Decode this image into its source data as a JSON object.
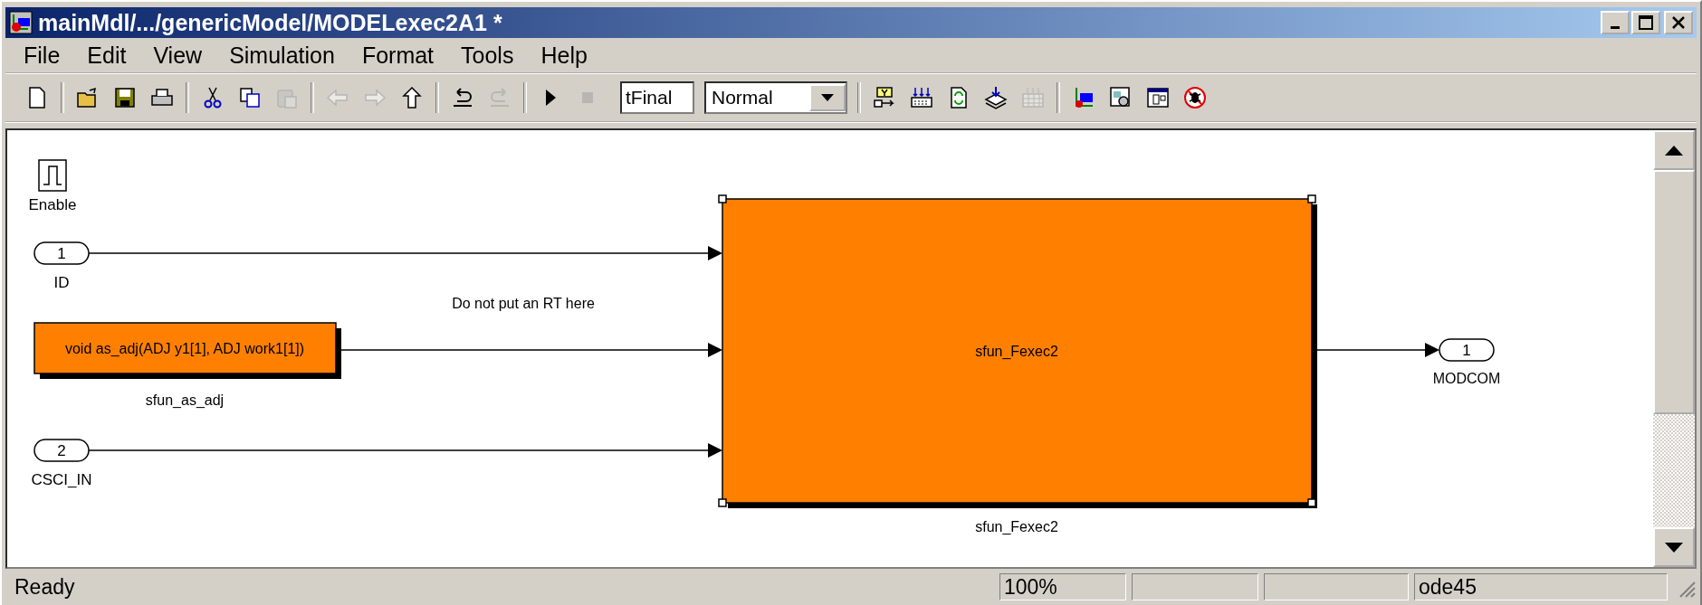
{
  "window": {
    "title": "mainMdl/.../genericModel/MODELexec2A1 *"
  },
  "menu": [
    {
      "label": "File"
    },
    {
      "label": "Edit"
    },
    {
      "label": "View"
    },
    {
      "label": "Simulation"
    },
    {
      "label": "Format"
    },
    {
      "label": "Tools"
    },
    {
      "label": "Help"
    }
  ],
  "toolbar": [
    {
      "kind": "new",
      "disabled": false
    },
    {
      "kind": "separator"
    },
    {
      "kind": "open",
      "disabled": false
    },
    {
      "kind": "save",
      "disabled": false
    },
    {
      "kind": "print",
      "disabled": false
    },
    {
      "kind": "separator"
    },
    {
      "kind": "cut",
      "disabled": false
    },
    {
      "kind": "copy",
      "disabled": false
    },
    {
      "kind": "paste",
      "disabled": true
    },
    {
      "kind": "separator"
    },
    {
      "kind": "back",
      "disabled": true
    },
    {
      "kind": "forward",
      "disabled": true
    },
    {
      "kind": "up",
      "disabled": false
    },
    {
      "kind": "separator"
    },
    {
      "kind": "undo",
      "disabled": false
    },
    {
      "kind": "redo",
      "disabled": true
    },
    {
      "kind": "separator"
    },
    {
      "kind": "play",
      "disabled": false
    },
    {
      "kind": "stop",
      "disabled": true
    },
    {
      "kind": "field",
      "value": "tFinal"
    },
    {
      "kind": "dropdown",
      "value": "Normal"
    },
    {
      "kind": "separator"
    },
    {
      "kind": "signal",
      "disabled": false
    },
    {
      "kind": "keyboard",
      "disabled": false
    },
    {
      "kind": "refresh",
      "disabled": false
    },
    {
      "kind": "stack",
      "disabled": false
    },
    {
      "kind": "grid",
      "disabled": true
    },
    {
      "kind": "separator"
    },
    {
      "kind": "model",
      "disabled": false
    },
    {
      "kind": "browser",
      "disabled": false
    },
    {
      "kind": "window",
      "disabled": false
    },
    {
      "kind": "debug",
      "disabled": false
    }
  ],
  "diagram": {
    "blocks": [
      {
        "kind": "enable",
        "name": "Enable",
        "selected": false
      },
      {
        "kind": "inport",
        "number": "1",
        "name": "ID",
        "selected": false
      },
      {
        "kind": "function",
        "text": "void as_adj(ADJ y1[1], ADJ work1[1])",
        "name": "sfun_as_adj",
        "selected": false
      },
      {
        "kind": "inport",
        "number": "2",
        "name": "CSCI_IN",
        "selected": false
      },
      {
        "kind": "subsystem",
        "text": "sfun_Fexec2",
        "name": "sfun_Fexec2",
        "selected": true
      },
      {
        "kind": "outport",
        "number": "1",
        "name": "MODCOM",
        "selected": false
      }
    ],
    "annotation": "Do not put an RT here"
  },
  "status_bar": {
    "message": "Ready",
    "zoom": "100%",
    "solver": "ode45"
  }
}
